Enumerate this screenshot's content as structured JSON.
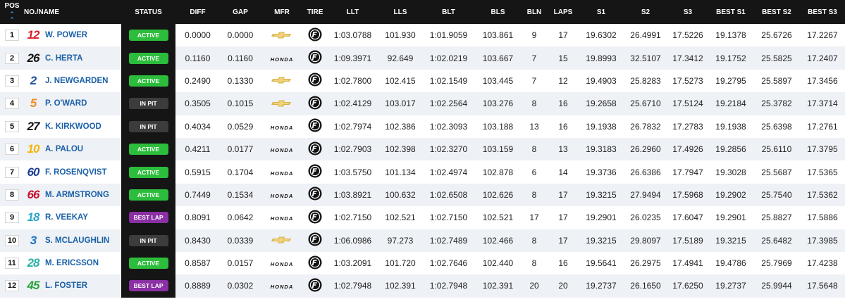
{
  "headers": {
    "pos": "POS",
    "name": "NO./NAME",
    "status": "STATUS",
    "diff": "DIFF",
    "gap": "GAP",
    "mfr": "MFR",
    "tire": "TIRE",
    "llt": "LLT",
    "lls": "LLS",
    "blt": "BLT",
    "bls": "BLS",
    "bln": "BLN",
    "laps": "LAPS",
    "s1": "S1",
    "s2": "S2",
    "s3": "S3",
    "best_s1": "BEST S1",
    "best_s2": "BEST S2",
    "best_s3": "BEST S3"
  },
  "icons": {
    "sort": "chevron-double-up-icon",
    "tire": "firestone-tire-icon",
    "chevrolet": "chevrolet-logo",
    "honda": "honda-logo"
  },
  "colors": {
    "active": "#2dbd3c",
    "in_pit": "#3c3c3c",
    "best_lap": "#8a2fa4",
    "name_blue": "#1b61a8"
  },
  "rows": [
    {
      "pos": "1",
      "num": "12",
      "numColor": "#d81e2a",
      "name": "W. POWER",
      "status": "ACTIVE",
      "statusType": "active",
      "diff": "0.0000",
      "gap": "0.0000",
      "mfr": "chevrolet",
      "llt": "1:03.0788",
      "lls": "101.930",
      "blt": "1:01.9059",
      "bls": "103.861",
      "bln": "9",
      "laps": "17",
      "s1": "19.6302",
      "s2": "26.4991",
      "s3": "17.5226",
      "best_s1": "19.1378",
      "best_s2": "25.6726",
      "best_s3": "17.2267"
    },
    {
      "pos": "2",
      "num": "26",
      "numColor": "#111111",
      "name": "C. HERTA",
      "status": "ACTIVE",
      "statusType": "active",
      "diff": "0.1160",
      "gap": "0.1160",
      "mfr": "honda",
      "mfrText": "HONDA",
      "llt": "1:09.3971",
      "lls": "92.649",
      "blt": "1:02.0219",
      "bls": "103.667",
      "bln": "7",
      "laps": "15",
      "s1": "19.8993",
      "s2": "32.5107",
      "s3": "17.3412",
      "best_s1": "19.1752",
      "best_s2": "25.5825",
      "best_s3": "17.2407"
    },
    {
      "pos": "3",
      "num": "2",
      "numColor": "#1b4fa0",
      "name": "J. NEWGARDEN",
      "status": "ACTIVE",
      "statusType": "active",
      "diff": "0.2490",
      "gap": "0.1330",
      "mfr": "chevrolet",
      "llt": "1:02.7800",
      "lls": "102.415",
      "blt": "1:02.1549",
      "bls": "103.445",
      "bln": "7",
      "laps": "12",
      "s1": "19.4903",
      "s2": "25.8283",
      "s3": "17.5273",
      "best_s1": "19.2795",
      "best_s2": "25.5897",
      "best_s3": "17.3456"
    },
    {
      "pos": "4",
      "num": "5",
      "numColor": "#f08a1c",
      "name": "P. O'WARD",
      "status": "IN PIT",
      "statusType": "in_pit",
      "diff": "0.3505",
      "gap": "0.1015",
      "mfr": "chevrolet",
      "llt": "1:02.4129",
      "lls": "103.017",
      "blt": "1:02.2564",
      "bls": "103.276",
      "bln": "8",
      "laps": "16",
      "s1": "19.2658",
      "s2": "25.6710",
      "s3": "17.5124",
      "best_s1": "19.2184",
      "best_s2": "25.3782",
      "best_s3": "17.3714"
    },
    {
      "pos": "5",
      "num": "27",
      "numColor": "#111111",
      "name": "K. KIRKWOOD",
      "status": "IN PIT",
      "statusType": "in_pit",
      "diff": "0.4034",
      "gap": "0.0529",
      "mfr": "honda",
      "mfrText": "HONDA",
      "llt": "1:02.7974",
      "lls": "102.386",
      "blt": "1:02.3093",
      "bls": "103.188",
      "bln": "13",
      "laps": "16",
      "s1": "19.1938",
      "s2": "26.7832",
      "s3": "17.2783",
      "best_s1": "19.1938",
      "best_s2": "25.6398",
      "best_s3": "17.2761"
    },
    {
      "pos": "6",
      "num": "10",
      "numColor": "#f2b705",
      "name": "A. PALOU",
      "status": "ACTIVE",
      "statusType": "active",
      "diff": "0.4211",
      "gap": "0.0177",
      "mfr": "honda",
      "mfrText": "HONDA",
      "llt": "1:02.7903",
      "lls": "102.398",
      "blt": "1:02.3270",
      "bls": "103.159",
      "bln": "8",
      "laps": "13",
      "s1": "19.3183",
      "s2": "26.2960",
      "s3": "17.4926",
      "best_s1": "19.2856",
      "best_s2": "25.6110",
      "best_s3": "17.3795"
    },
    {
      "pos": "7",
      "num": "60",
      "numColor": "#1c3f94",
      "name": "F. ROSENQVIST",
      "status": "ACTIVE",
      "statusType": "active",
      "diff": "0.5915",
      "gap": "0.1704",
      "mfr": "honda",
      "mfrText": "HONDA",
      "llt": "1:03.5750",
      "lls": "101.134",
      "blt": "1:02.4974",
      "bls": "102.878",
      "bln": "6",
      "laps": "14",
      "s1": "19.3736",
      "s2": "26.6386",
      "s3": "17.7947",
      "best_s1": "19.3028",
      "best_s2": "25.5687",
      "best_s3": "17.5365"
    },
    {
      "pos": "8",
      "num": "66",
      "numColor": "#c8102e",
      "name": "M. ARMSTRONG",
      "status": "ACTIVE",
      "statusType": "active",
      "diff": "0.7449",
      "gap": "0.1534",
      "mfr": "honda",
      "mfrText": "HONDA",
      "llt": "1:03.8921",
      "lls": "100.632",
      "blt": "1:02.6508",
      "bls": "102.626",
      "bln": "8",
      "laps": "17",
      "s1": "19.3215",
      "s2": "27.9494",
      "s3": "17.5968",
      "best_s1": "19.2902",
      "best_s2": "25.7540",
      "best_s3": "17.5362"
    },
    {
      "pos": "9",
      "num": "18",
      "numColor": "#2aa7c9",
      "name": "R. VEEKAY",
      "status": "BEST LAP",
      "statusType": "best_lap",
      "diff": "0.8091",
      "gap": "0.0642",
      "mfr": "honda",
      "mfrText": "HONDA",
      "llt": "1:02.7150",
      "lls": "102.521",
      "blt": "1:02.7150",
      "bls": "102.521",
      "bln": "17",
      "laps": "17",
      "s1": "19.2901",
      "s2": "26.0235",
      "s3": "17.6047",
      "best_s1": "19.2901",
      "best_s2": "25.8827",
      "best_s3": "17.5886"
    },
    {
      "pos": "10",
      "num": "3",
      "numColor": "#1e73c7",
      "name": "S. MCLAUGHLIN",
      "status": "IN PIT",
      "statusType": "in_pit",
      "diff": "0.8430",
      "gap": "0.0339",
      "mfr": "chevrolet",
      "llt": "1:06.0986",
      "lls": "97.273",
      "blt": "1:02.7489",
      "bls": "102.466",
      "bln": "8",
      "laps": "17",
      "s1": "19.3215",
      "s2": "29.8097",
      "s3": "17.5189",
      "best_s1": "19.3215",
      "best_s2": "25.6482",
      "best_s3": "17.3985"
    },
    {
      "pos": "11",
      "num": "28",
      "numColor": "#27b3a6",
      "name": "M. ERICSSON",
      "status": "ACTIVE",
      "statusType": "active",
      "diff": "0.8587",
      "gap": "0.0157",
      "mfr": "honda",
      "mfrText": "HONDA",
      "llt": "1:03.2091",
      "lls": "101.720",
      "blt": "1:02.7646",
      "bls": "102.440",
      "bln": "8",
      "laps": "16",
      "s1": "19.5641",
      "s2": "26.2975",
      "s3": "17.4941",
      "best_s1": "19.4786",
      "best_s2": "25.7969",
      "best_s3": "17.4238"
    },
    {
      "pos": "12",
      "num": "45",
      "numColor": "#29a33a",
      "name": "L. FOSTER",
      "status": "BEST LAP",
      "statusType": "best_lap",
      "diff": "0.8889",
      "gap": "0.0302",
      "mfr": "honda",
      "mfrText": "HONDA",
      "llt": "1:02.7948",
      "lls": "102.391",
      "blt": "1:02.7948",
      "bls": "102.391",
      "bln": "20",
      "laps": "20",
      "s1": "19.2737",
      "s2": "26.1650",
      "s3": "17.6250",
      "best_s1": "19.2737",
      "best_s2": "25.9944",
      "best_s3": "17.5648"
    }
  ]
}
